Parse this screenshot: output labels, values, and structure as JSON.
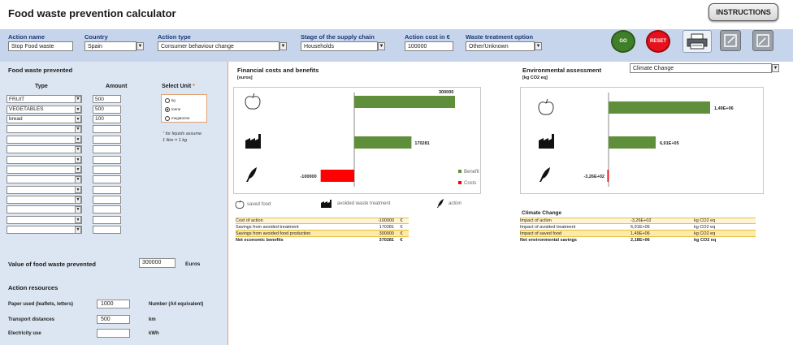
{
  "header": {
    "title": "Food waste prevention calculator",
    "instructions_label": "INSTRUCTIONS"
  },
  "action_bar": {
    "action_name": {
      "label": "Action name",
      "value": "Stop Food waste"
    },
    "country": {
      "label": "Country",
      "value": "Spain"
    },
    "action_type": {
      "label": "Action type",
      "value": "Consumer behaviour change"
    },
    "stage": {
      "label": "Stage of the supply chain",
      "value": "Households"
    },
    "cost": {
      "label": "Action cost in €",
      "value": "100000"
    },
    "treatment": {
      "label": "Waste treatment option",
      "value": "Other/Unknown"
    },
    "go_label": "GO",
    "reset_label": "RESET"
  },
  "food_waste": {
    "title": "Food waste prevented",
    "type_header": "Type",
    "amount_header": "Amount",
    "unit_header": "Select Unit",
    "unit_star": "*",
    "rows": [
      {
        "type": "FRUIT",
        "amount": "500"
      },
      {
        "type": "VEGETABLES",
        "amount": "500"
      },
      {
        "type": "bread",
        "amount": "100"
      },
      {
        "type": "",
        "amount": ""
      },
      {
        "type": "",
        "amount": ""
      },
      {
        "type": "",
        "amount": ""
      },
      {
        "type": "",
        "amount": ""
      },
      {
        "type": "",
        "amount": ""
      },
      {
        "type": "",
        "amount": ""
      },
      {
        "type": "",
        "amount": ""
      },
      {
        "type": "",
        "amount": ""
      },
      {
        "type": "",
        "amount": ""
      },
      {
        "type": "",
        "amount": ""
      },
      {
        "type": "",
        "amount": ""
      }
    ],
    "units": [
      {
        "label": "kg",
        "selected": false
      },
      {
        "label": "tonne",
        "selected": true
      },
      {
        "label": "megatonne",
        "selected": false
      }
    ],
    "note_star": "*",
    "note_line1": "for liquids assume",
    "note_line2": "1 litre = 1 kg"
  },
  "value_prevented": {
    "label": "Value of food waste prevented",
    "value": "300000",
    "unit": "Euros"
  },
  "resources": {
    "title": "Action resources",
    "rows": [
      {
        "label": "Paper used (leaflets, letters)",
        "value": "1000",
        "unit": "Number (A4 equivalent)"
      },
      {
        "label": "Transport distances",
        "value": "500",
        "unit": "km"
      },
      {
        "label": "Electricity use",
        "value": "",
        "unit": "kWh"
      }
    ]
  },
  "financial": {
    "title": "Financial costs and benefits",
    "unit": "[euros]",
    "legend_benefit": "Benefit",
    "legend_costs": "Costs",
    "icon_legend": {
      "saved": "saved food",
      "avoided": "avoided waste treatment",
      "action": "action"
    },
    "table": [
      {
        "label": "Cost of action",
        "value": "-100000",
        "unit": "€"
      },
      {
        "label": "Savings from avoided treatment",
        "value": "170281",
        "unit": "€"
      },
      {
        "label": "Savings from avoided food production",
        "value": "300000",
        "unit": "€"
      },
      {
        "label": "Net economic benefits",
        "value": "370281",
        "unit": "€"
      }
    ]
  },
  "environmental": {
    "title": "Environmental assessment",
    "unit": "[kg CO2 eq]",
    "selector_value": "Climate Change",
    "table_title": "Climate Change",
    "table": [
      {
        "label": "Impact of action",
        "value": "-3,26E+02",
        "unit": "kg CO2 eq"
      },
      {
        "label": "Impact of avoided treatment",
        "value": "6,91E+05",
        "unit": "kg CO2 eq"
      },
      {
        "label": "Impact of saved food",
        "value": "1,49E+06",
        "unit": "kg CO2 eq"
      },
      {
        "label": "Net environmental savings",
        "value": "2,18E+06",
        "unit": "kg CO2 eq"
      }
    ]
  },
  "chart_data": [
    {
      "type": "bar",
      "orientation": "horizontal",
      "categories": [
        "saved food",
        "avoided waste treatment",
        "action"
      ],
      "series": [
        {
          "name": "Benefit",
          "values": [
            300000,
            170281,
            0
          ]
        },
        {
          "name": "Costs",
          "values": [
            0,
            0,
            -100000
          ]
        }
      ],
      "data_labels": [
        "300000",
        "170281",
        "-100000"
      ],
      "xlim": [
        -150000,
        310000
      ],
      "colors": {
        "Benefit": "#5f8f3a",
        "Costs": "#ff0000"
      }
    },
    {
      "type": "bar",
      "orientation": "horizontal",
      "categories": [
        "saved food",
        "avoided waste treatment",
        "action"
      ],
      "values": [
        1490000,
        691000,
        -326
      ],
      "data_labels": [
        "1,49E+06",
        "6,91E+05",
        "-3,26E+02"
      ],
      "xlim": [
        -50000,
        1750000
      ],
      "colors": {
        "positive": "#5f8f3a",
        "negative": "#ff0000"
      }
    }
  ]
}
